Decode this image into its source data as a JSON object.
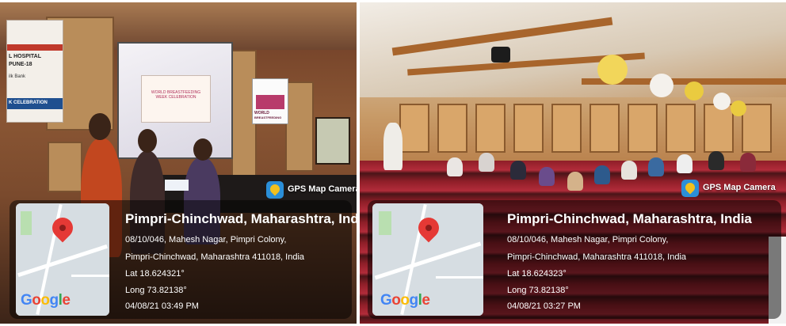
{
  "photos": [
    {
      "overlay": {
        "app_label": "GPS Map Camera",
        "place_title": "Pimpri-Chinchwad, Maharashtra, India",
        "address_line_1": "08/10/046, Mahesh Nagar, Pimpri Colony,",
        "address_line_2": "Pimpri-Chinchwad, Maharashtra 411018, India",
        "latitude": "Lat 18.624321°",
        "longitude": "Long 73.82138°",
        "datetime": "04/08/21 03:49 PM",
        "map_brand": {
          "g1": "G",
          "o1": "o",
          "o2": "o",
          "g2": "g",
          "l": "l",
          "e": "e"
        }
      },
      "scene_text": {
        "banner_lines": [
          "L HOSPITAL",
          "PUNE-18",
          "ilk Bank",
          "K CELEBRATION"
        ],
        "screen_title": "WORLD BREASTFEEDING WEEK CELEBRATION",
        "poster_lines": [
          "WORLD",
          "BREASTFEEDING",
          "WEEK"
        ]
      }
    },
    {
      "overlay": {
        "app_label": "GPS Map Camera",
        "place_title": "Pimpri-Chinchwad, Maharashtra, India",
        "address_line_1": "08/10/046, Mahesh Nagar, Pimpri Colony,",
        "address_line_2": "Pimpri-Chinchwad, Maharashtra 411018, India",
        "latitude": "Lat 18.624323°",
        "longitude": "Long 73.82138°",
        "datetime": "04/08/21 03:27 PM",
        "map_brand": {
          "g1": "G",
          "o1": "o",
          "o2": "o",
          "g2": "g",
          "l": "l",
          "e": "e"
        }
      }
    }
  ],
  "colors": {
    "pin": "#e53935",
    "app_logo": "#2b8fd8",
    "overlay_text": "#ffffff"
  }
}
